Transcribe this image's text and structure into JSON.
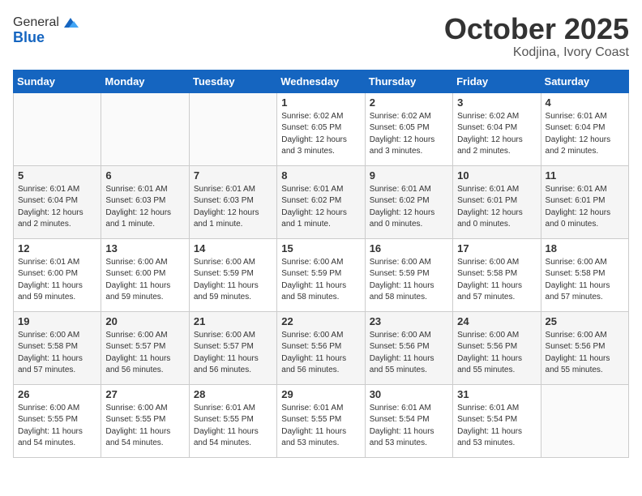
{
  "logo": {
    "general": "General",
    "blue": "Blue"
  },
  "header": {
    "month": "October 2025",
    "location": "Kodjina, Ivory Coast"
  },
  "weekdays": [
    "Sunday",
    "Monday",
    "Tuesday",
    "Wednesday",
    "Thursday",
    "Friday",
    "Saturday"
  ],
  "weeks": [
    [
      {
        "day": "",
        "info": ""
      },
      {
        "day": "",
        "info": ""
      },
      {
        "day": "",
        "info": ""
      },
      {
        "day": "1",
        "info": "Sunrise: 6:02 AM\nSunset: 6:05 PM\nDaylight: 12 hours and 3 minutes."
      },
      {
        "day": "2",
        "info": "Sunrise: 6:02 AM\nSunset: 6:05 PM\nDaylight: 12 hours and 3 minutes."
      },
      {
        "day": "3",
        "info": "Sunrise: 6:02 AM\nSunset: 6:04 PM\nDaylight: 12 hours and 2 minutes."
      },
      {
        "day": "4",
        "info": "Sunrise: 6:01 AM\nSunset: 6:04 PM\nDaylight: 12 hours and 2 minutes."
      }
    ],
    [
      {
        "day": "5",
        "info": "Sunrise: 6:01 AM\nSunset: 6:04 PM\nDaylight: 12 hours and 2 minutes."
      },
      {
        "day": "6",
        "info": "Sunrise: 6:01 AM\nSunset: 6:03 PM\nDaylight: 12 hours and 1 minute."
      },
      {
        "day": "7",
        "info": "Sunrise: 6:01 AM\nSunset: 6:03 PM\nDaylight: 12 hours and 1 minute."
      },
      {
        "day": "8",
        "info": "Sunrise: 6:01 AM\nSunset: 6:02 PM\nDaylight: 12 hours and 1 minute."
      },
      {
        "day": "9",
        "info": "Sunrise: 6:01 AM\nSunset: 6:02 PM\nDaylight: 12 hours and 0 minutes."
      },
      {
        "day": "10",
        "info": "Sunrise: 6:01 AM\nSunset: 6:01 PM\nDaylight: 12 hours and 0 minutes."
      },
      {
        "day": "11",
        "info": "Sunrise: 6:01 AM\nSunset: 6:01 PM\nDaylight: 12 hours and 0 minutes."
      }
    ],
    [
      {
        "day": "12",
        "info": "Sunrise: 6:01 AM\nSunset: 6:00 PM\nDaylight: 11 hours and 59 minutes."
      },
      {
        "day": "13",
        "info": "Sunrise: 6:00 AM\nSunset: 6:00 PM\nDaylight: 11 hours and 59 minutes."
      },
      {
        "day": "14",
        "info": "Sunrise: 6:00 AM\nSunset: 5:59 PM\nDaylight: 11 hours and 59 minutes."
      },
      {
        "day": "15",
        "info": "Sunrise: 6:00 AM\nSunset: 5:59 PM\nDaylight: 11 hours and 58 minutes."
      },
      {
        "day": "16",
        "info": "Sunrise: 6:00 AM\nSunset: 5:59 PM\nDaylight: 11 hours and 58 minutes."
      },
      {
        "day": "17",
        "info": "Sunrise: 6:00 AM\nSunset: 5:58 PM\nDaylight: 11 hours and 57 minutes."
      },
      {
        "day": "18",
        "info": "Sunrise: 6:00 AM\nSunset: 5:58 PM\nDaylight: 11 hours and 57 minutes."
      }
    ],
    [
      {
        "day": "19",
        "info": "Sunrise: 6:00 AM\nSunset: 5:58 PM\nDaylight: 11 hours and 57 minutes."
      },
      {
        "day": "20",
        "info": "Sunrise: 6:00 AM\nSunset: 5:57 PM\nDaylight: 11 hours and 56 minutes."
      },
      {
        "day": "21",
        "info": "Sunrise: 6:00 AM\nSunset: 5:57 PM\nDaylight: 11 hours and 56 minutes."
      },
      {
        "day": "22",
        "info": "Sunrise: 6:00 AM\nSunset: 5:56 PM\nDaylight: 11 hours and 56 minutes."
      },
      {
        "day": "23",
        "info": "Sunrise: 6:00 AM\nSunset: 5:56 PM\nDaylight: 11 hours and 55 minutes."
      },
      {
        "day": "24",
        "info": "Sunrise: 6:00 AM\nSunset: 5:56 PM\nDaylight: 11 hours and 55 minutes."
      },
      {
        "day": "25",
        "info": "Sunrise: 6:00 AM\nSunset: 5:56 PM\nDaylight: 11 hours and 55 minutes."
      }
    ],
    [
      {
        "day": "26",
        "info": "Sunrise: 6:00 AM\nSunset: 5:55 PM\nDaylight: 11 hours and 54 minutes."
      },
      {
        "day": "27",
        "info": "Sunrise: 6:00 AM\nSunset: 5:55 PM\nDaylight: 11 hours and 54 minutes."
      },
      {
        "day": "28",
        "info": "Sunrise: 6:01 AM\nSunset: 5:55 PM\nDaylight: 11 hours and 54 minutes."
      },
      {
        "day": "29",
        "info": "Sunrise: 6:01 AM\nSunset: 5:55 PM\nDaylight: 11 hours and 53 minutes."
      },
      {
        "day": "30",
        "info": "Sunrise: 6:01 AM\nSunset: 5:54 PM\nDaylight: 11 hours and 53 minutes."
      },
      {
        "day": "31",
        "info": "Sunrise: 6:01 AM\nSunset: 5:54 PM\nDaylight: 11 hours and 53 minutes."
      },
      {
        "day": "",
        "info": ""
      }
    ]
  ]
}
